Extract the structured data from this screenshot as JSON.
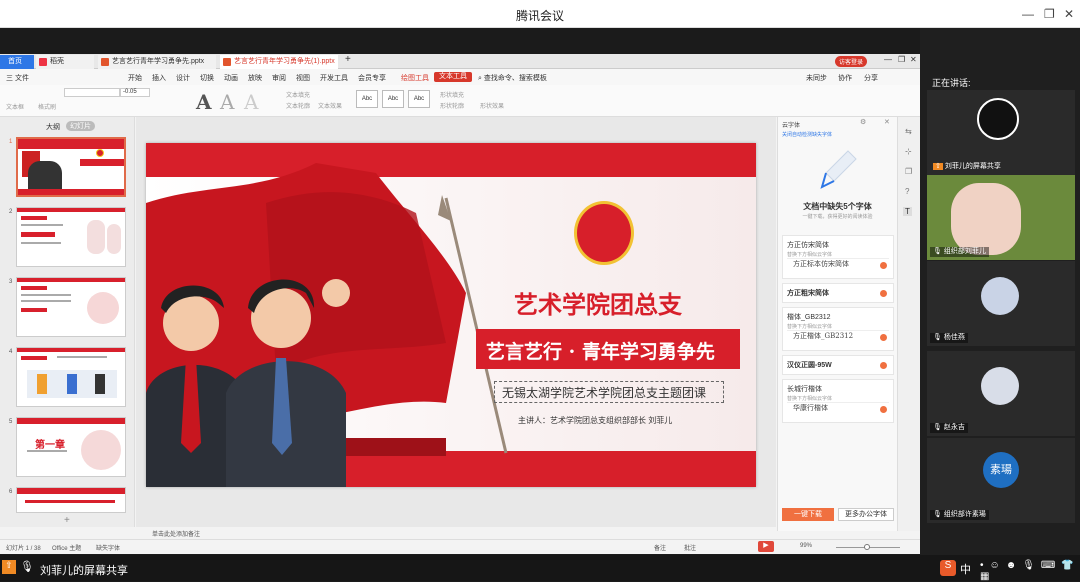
{
  "window": {
    "title": "腾讯会议"
  },
  "wps": {
    "tabs": [
      {
        "label": "首页"
      },
      {
        "label": "稻壳"
      },
      {
        "label": "艺言艺行青年学习勇争先.pptx"
      },
      {
        "label": "艺言艺行青年学习勇争先(1).pptx"
      }
    ],
    "login": "访客登录",
    "menu": [
      "三 文件",
      "开始",
      "插入",
      "设计",
      "切换",
      "动画",
      "放映",
      "审阅",
      "视图",
      "开发工具",
      "会员专享",
      "绘图工具",
      "文本工具"
    ],
    "search": "查找命令、搜索模板",
    "menu_right": [
      "未同步",
      "协作",
      "分享"
    ],
    "ribbon": {
      "font_size": "-0.05",
      "labels": [
        "文本框",
        "格式刷",
        "文本填充",
        "文本轮廓",
        "文本效果",
        "形状填充",
        "形状轮廓",
        "形状效果"
      ],
      "abc": [
        "Abc",
        "Abc",
        "Abc"
      ],
      "big_a": [
        "A",
        "A",
        "A"
      ]
    },
    "left_tabs": [
      "大纲",
      "幻灯片"
    ],
    "thumb_nums": [
      "1",
      "2",
      "3",
      "4",
      "5",
      "6"
    ],
    "thumb5_title": "第一章",
    "slide": {
      "org_title": "艺术学院团总支",
      "main_title": "艺言艺行 · 青年学习勇争先",
      "subtitle": "无锡太湖学院艺术学院团总支主题团课",
      "speaker": "主讲人：艺术学院团总支组织部部长   刘菲儿"
    },
    "font_panel": {
      "header": "云字体",
      "note": "关闭自动检测缺失字体",
      "missing_title": "文档中缺失5个字体",
      "missing_sub": "一键下载，获得更好的阅读体验",
      "fonts": [
        {
          "name": "方正仿宋简体",
          "hint": "替换下方相似云字体",
          "alt": "方正标本仿宋简体"
        },
        {
          "name": "方正粗宋简体",
          "hint": "",
          "alt": ""
        },
        {
          "name": "楷体_GB2312",
          "hint": "替换下方相似云字体",
          "alt": "方正楷体_GB2312"
        },
        {
          "name": "汉仪正圆-95W",
          "hint": "",
          "alt": ""
        },
        {
          "name": "长城行楷体",
          "hint": "替换下方相似云字体",
          "alt": "华康行楷体"
        }
      ],
      "btn_download": "一键下载",
      "btn_more": "更多办公字体"
    },
    "notes_hint": "单击此处添加备注",
    "status": {
      "slide_count": "幻灯片 1 / 38",
      "theme": "Office 主题",
      "missing_font": "缺失字体",
      "notes": "备注",
      "comment": "批注",
      "zoom": "99%"
    }
  },
  "meeting": {
    "speaking_label": "正在讲话:",
    "participants": [
      {
        "name": "刘菲儿的屏幕共享",
        "kind": "share"
      },
      {
        "name": "组织部刘菲儿",
        "kind": "video"
      },
      {
        "name": "杨佳燕",
        "kind": "avatar"
      },
      {
        "name": "赵永吉",
        "kind": "avatar"
      },
      {
        "name": "组织部许素瑒",
        "kind": "initial",
        "initials": "素瑒",
        "color": "#1f6fc2"
      }
    ],
    "bottom_share_label": "刘菲儿的屏幕共享",
    "ime": "中"
  }
}
